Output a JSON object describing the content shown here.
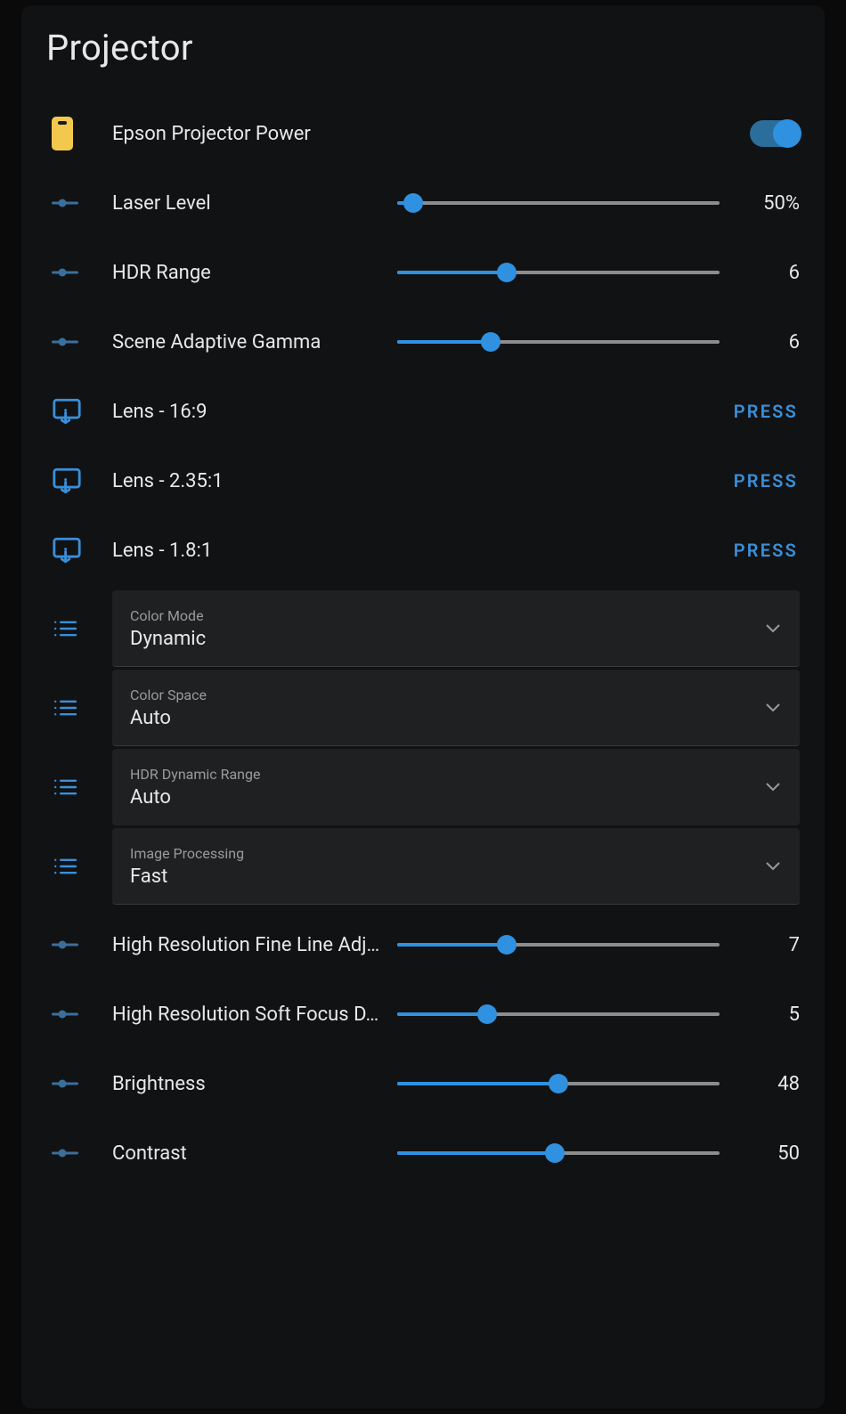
{
  "title": "Projector",
  "power": {
    "label": "Epson Projector Power",
    "on": true
  },
  "sliders": {
    "laser": {
      "label": "Laser Level",
      "value_text": "50%",
      "percent": 5
    },
    "hdr": {
      "label": "HDR Range",
      "value_text": "6",
      "percent": 34
    },
    "gamma": {
      "label": "Scene Adaptive Gamma",
      "value_text": "6",
      "percent": 29
    },
    "fine": {
      "label": "High Resolution Fine Line Adj…",
      "value_text": "7",
      "percent": 34
    },
    "soft": {
      "label": "High Resolution Soft Focus D…",
      "value_text": "5",
      "percent": 28
    },
    "bright": {
      "label": "Brightness",
      "value_text": "48",
      "percent": 50
    },
    "contrast": {
      "label": "Contrast",
      "value_text": "50",
      "percent": 49
    }
  },
  "presses": {
    "lens169": {
      "label": "Lens - 16:9",
      "action": "PRESS"
    },
    "lens235": {
      "label": "Lens - 2.35:1",
      "action": "PRESS"
    },
    "lens18": {
      "label": "Lens - 1.8:1",
      "action": "PRESS"
    }
  },
  "dropdowns": {
    "color_mode": {
      "label": "Color Mode",
      "value": "Dynamic"
    },
    "color_space": {
      "label": "Color Space",
      "value": "Auto"
    },
    "hdr_range": {
      "label": "HDR Dynamic Range",
      "value": "Auto"
    },
    "img_proc": {
      "label": "Image Processing",
      "value": "Fast"
    }
  }
}
